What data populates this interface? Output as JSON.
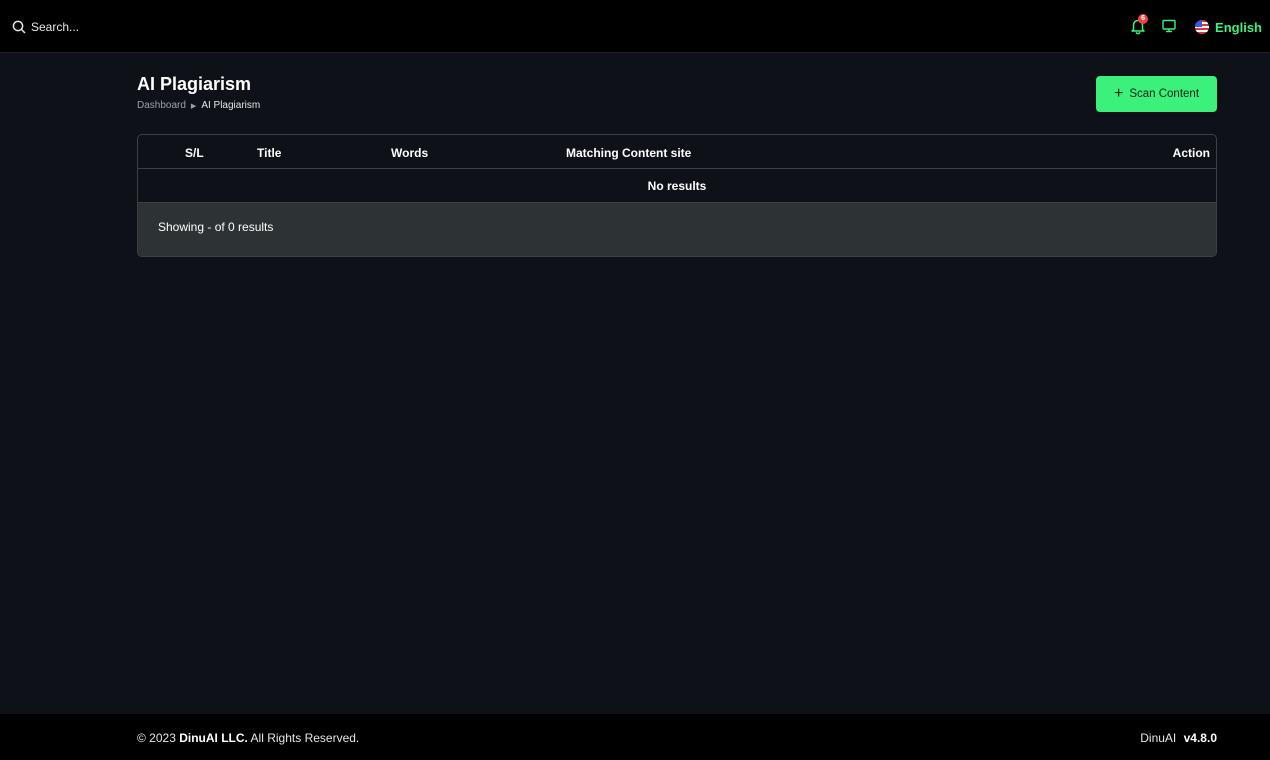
{
  "topbar": {
    "search_placeholder": "Search...",
    "notification_count": "6",
    "language": "English"
  },
  "header": {
    "title": "AI Plagiarism",
    "breadcrumb": [
      "Dashboard",
      "AI Plagiarism"
    ],
    "scan_button": "Scan Content"
  },
  "table": {
    "columns": [
      "S/L",
      "Title",
      "Words",
      "Matching Content site",
      "Action"
    ],
    "empty_text": "No results",
    "summary": "Showing - of 0 results"
  },
  "footer": {
    "copyright_prefix": "© 2023",
    "company": "DinuAI LLC.",
    "rights": "All Rights Reserved.",
    "product": "DinuAI",
    "version": "v4.8.0"
  },
  "colors": {
    "accent": "#3cf07c",
    "background": "#0e1218",
    "bar": "#000000",
    "badge": "#ef4444"
  },
  "icons": [
    "search-icon",
    "bell-icon",
    "monitor-icon",
    "us-flag-icon",
    "plus-icon",
    "caret-right-icon"
  ]
}
